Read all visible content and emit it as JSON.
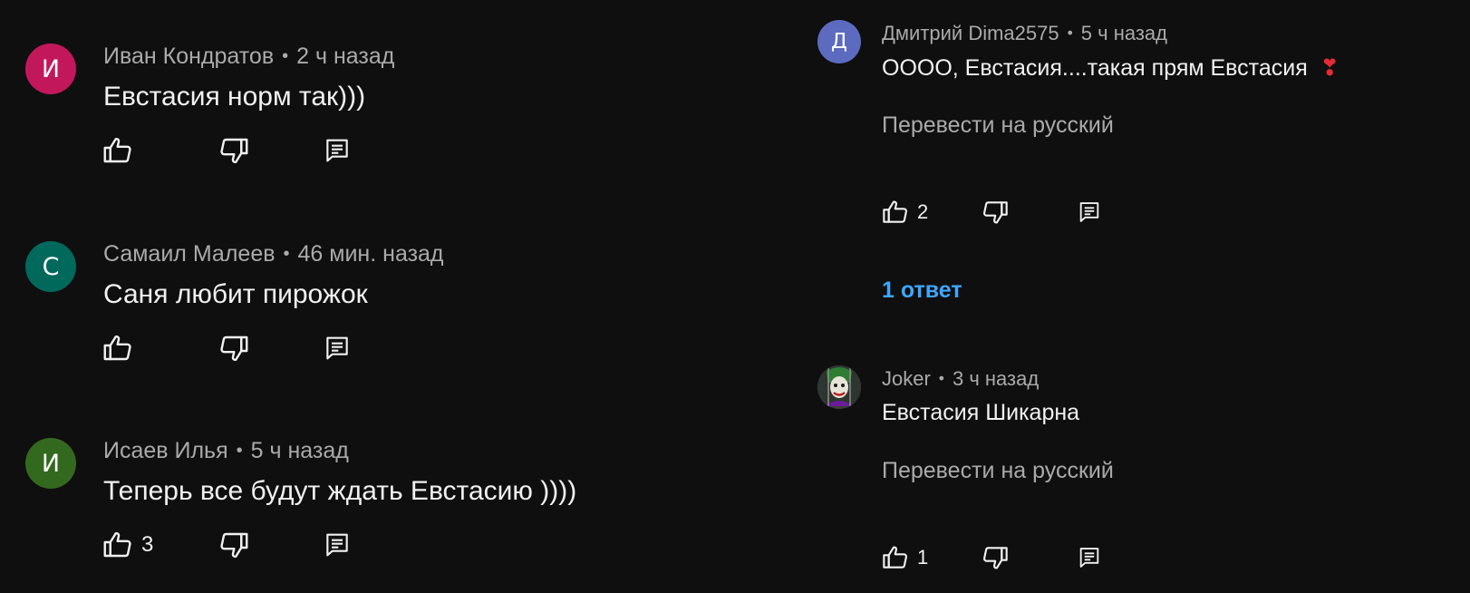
{
  "left_comments": [
    {
      "avatar_letter": "И",
      "avatar_color": "#c2185b",
      "author": "Иван Кондратов",
      "time": "2 ч назад",
      "text": "Евстасия норм так)))",
      "likes": ""
    },
    {
      "avatar_letter": "С",
      "avatar_color": "#00695c",
      "author": "Самаил Малеев",
      "time": "46 мин. назад",
      "text": "Саня любит пирожок",
      "likes": ""
    },
    {
      "avatar_letter": "И",
      "avatar_color": "#33691e",
      "author": "Исаев Илья",
      "time": "5 ч назад",
      "text": "Теперь все будут ждать Евстасию ))))",
      "likes": "3"
    }
  ],
  "right_comments": [
    {
      "avatar_letter": "Д",
      "avatar_color": "#5c6bc0",
      "author": "Дмитрий Dima2575",
      "time": "5 ч назад",
      "text": "ОООО, Евстасия....такая прям Евстасия",
      "emoji": "❣",
      "translate": "Перевести на русский",
      "likes": "2",
      "replies": "1 ответ"
    },
    {
      "avatar_letter": "",
      "avatar_color": "#3a3f3a",
      "author": "Joker",
      "time": "3 ч назад",
      "text": "Евстасия Шикарна",
      "translate": "Перевести на русский",
      "likes": "1"
    }
  ],
  "separator": "•",
  "icons": {
    "like": "thumb-up-icon",
    "dislike": "thumb-down-icon",
    "reply": "reply-comment-icon"
  }
}
